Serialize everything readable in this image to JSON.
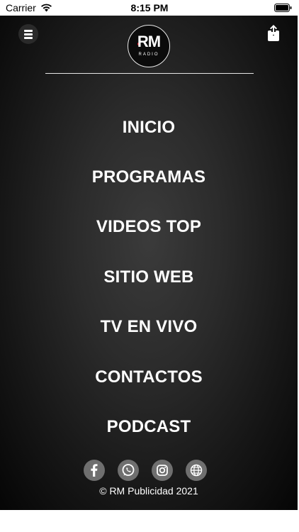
{
  "status_bar": {
    "carrier": "Carrier",
    "time": "8:15 PM"
  },
  "header": {
    "logo_text": "RM",
    "logo_subtext": "RADIO",
    "menu_icon": "hamburger-icon",
    "share_icon": "share-icon"
  },
  "nav": {
    "items": [
      {
        "label": "INICIO"
      },
      {
        "label": "PROGRAMAS"
      },
      {
        "label": "VIDEOS TOP"
      },
      {
        "label": "SITIO WEB"
      },
      {
        "label": "TV EN VIVO"
      },
      {
        "label": "CONTACTOS"
      },
      {
        "label": "PODCAST"
      }
    ]
  },
  "social": {
    "icons": [
      "facebook-icon",
      "whatsapp-icon",
      "instagram-icon",
      "globe-icon"
    ]
  },
  "footer": {
    "copyright": "© RM Publicidad 2021"
  },
  "colors": {
    "panel": "#0a0a0a",
    "text": "#ffffff",
    "social_bg": "#6f6f6f",
    "logo_dot": "#d7192a"
  }
}
